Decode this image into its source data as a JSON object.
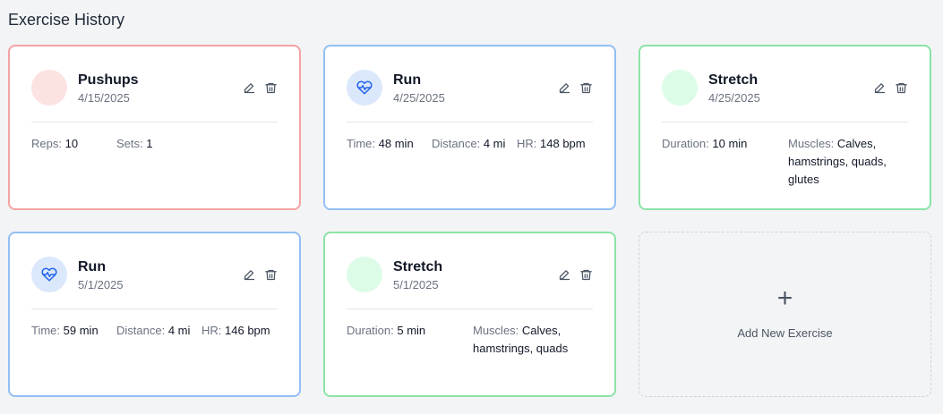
{
  "header": {
    "title": "Exercise History"
  },
  "colors": {
    "strength_border": "#f4a3a3",
    "cardio_border": "#93bff5",
    "flexibility_border": "#8be3a6",
    "cardio_icon": "#2563eb"
  },
  "cards": [
    {
      "type": "strength",
      "icon": "none",
      "title": "Pushups",
      "date": "4/15/2025",
      "stats": [
        {
          "label": "Reps:",
          "value": "10"
        },
        {
          "label": "Sets:",
          "value": "1"
        }
      ]
    },
    {
      "type": "cardio",
      "icon": "heart-pulse-icon",
      "title": "Run",
      "date": "4/25/2025",
      "stats": [
        {
          "label": "Time:",
          "value": "48 min"
        },
        {
          "label": "Distance:",
          "value": "4 mi"
        },
        {
          "label": "HR:",
          "value": "148 bpm"
        }
      ]
    },
    {
      "type": "flexibility",
      "icon": "none",
      "title": "Stretch",
      "date": "4/25/2025",
      "stats": [
        {
          "label": "Duration:",
          "value": "10 min"
        },
        {
          "label": "Muscles:",
          "value": "Calves, hamstrings, quads, glutes"
        }
      ]
    },
    {
      "type": "cardio",
      "icon": "heart-pulse-icon",
      "title": "Run",
      "date": "5/1/2025",
      "stats": [
        {
          "label": "Time:",
          "value": "59 min"
        },
        {
          "label": "Distance:",
          "value": "4 mi"
        },
        {
          "label": "HR:",
          "value": "146 bpm"
        }
      ]
    },
    {
      "type": "flexibility",
      "icon": "none",
      "title": "Stretch",
      "date": "5/1/2025",
      "stats": [
        {
          "label": "Duration:",
          "value": "5 min"
        },
        {
          "label": "Muscles:",
          "value": "Calves, hamstrings, quads"
        }
      ]
    }
  ],
  "add_card": {
    "icon": "plus-icon",
    "plus": "+",
    "label": "Add New Exercise"
  }
}
